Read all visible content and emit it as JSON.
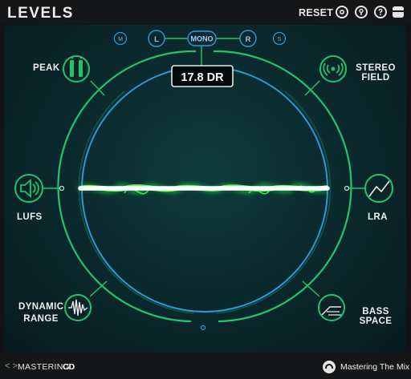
{
  "header": {
    "title": "LEVELS",
    "reset_label": "RESET",
    "buttons": [
      "settings-icon",
      "info-icon",
      "help-icon",
      "menu-icon"
    ]
  },
  "channels": {
    "m": "M",
    "l": "L",
    "mono": "MONO",
    "r": "R",
    "s": "S",
    "active": "MONO"
  },
  "readout": "17.8 DR",
  "modules": {
    "peak": "PEAK",
    "stereo_field": "STEREO FIELD",
    "lufs": "LUFS",
    "lra": "LRA",
    "dynamic_range_line1": "DYNAMIC",
    "dynamic_range_line2": "RANGE",
    "bass_space": "BASS SPACE"
  },
  "footer": {
    "nav": "< >",
    "product_prefix": "MASTERING",
    "product_suffix": "CD",
    "brand": "Mastering The Mix"
  },
  "colors": {
    "accent_green": "#22c46a",
    "ring_blue": "#2b9ad6",
    "glow": "#9bff9b",
    "background": "#0b2b2f"
  }
}
